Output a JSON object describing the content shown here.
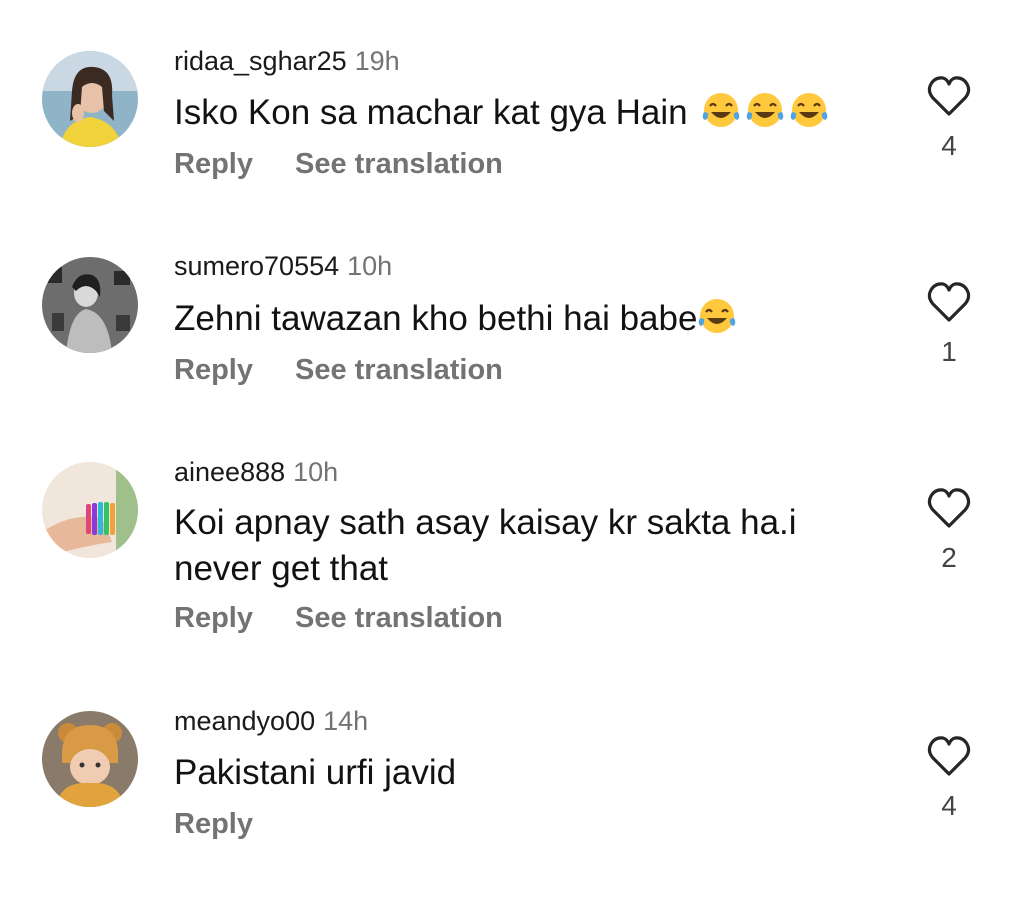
{
  "comments": [
    {
      "username": "ridaa_sghar25",
      "time": "19h",
      "text": "Isko Kon sa machar kat gya Hain",
      "emoji_count": 3,
      "emoji": "tears-of-joy-icon",
      "reply_label": "Reply",
      "translate_label": "See translation",
      "likes": "4"
    },
    {
      "username": "sumero70554",
      "time": "10h",
      "text": "Zehni tawazan kho bethi hai babe",
      "emoji_count": 1,
      "emoji": "tears-of-joy-icon",
      "reply_label": "Reply",
      "translate_label": "See translation",
      "likes": "1"
    },
    {
      "username": "ainee888",
      "time": "10h",
      "text": "Koi apnay sath asay kaisay kr sakta ha.i never get that",
      "reply_label": "Reply",
      "translate_label": "See translation",
      "likes": "2"
    },
    {
      "username": "meandyo00",
      "time": "14h",
      "text": "Pakistani urfi javid",
      "reply_label": "Reply",
      "likes": "4"
    }
  ],
  "colors": {
    "text": "#121212",
    "secondary": "#737373",
    "emoji_face": "#FFC83D",
    "tear": "#4FA3E0"
  },
  "icons": {
    "like": "heart-outline-icon"
  }
}
